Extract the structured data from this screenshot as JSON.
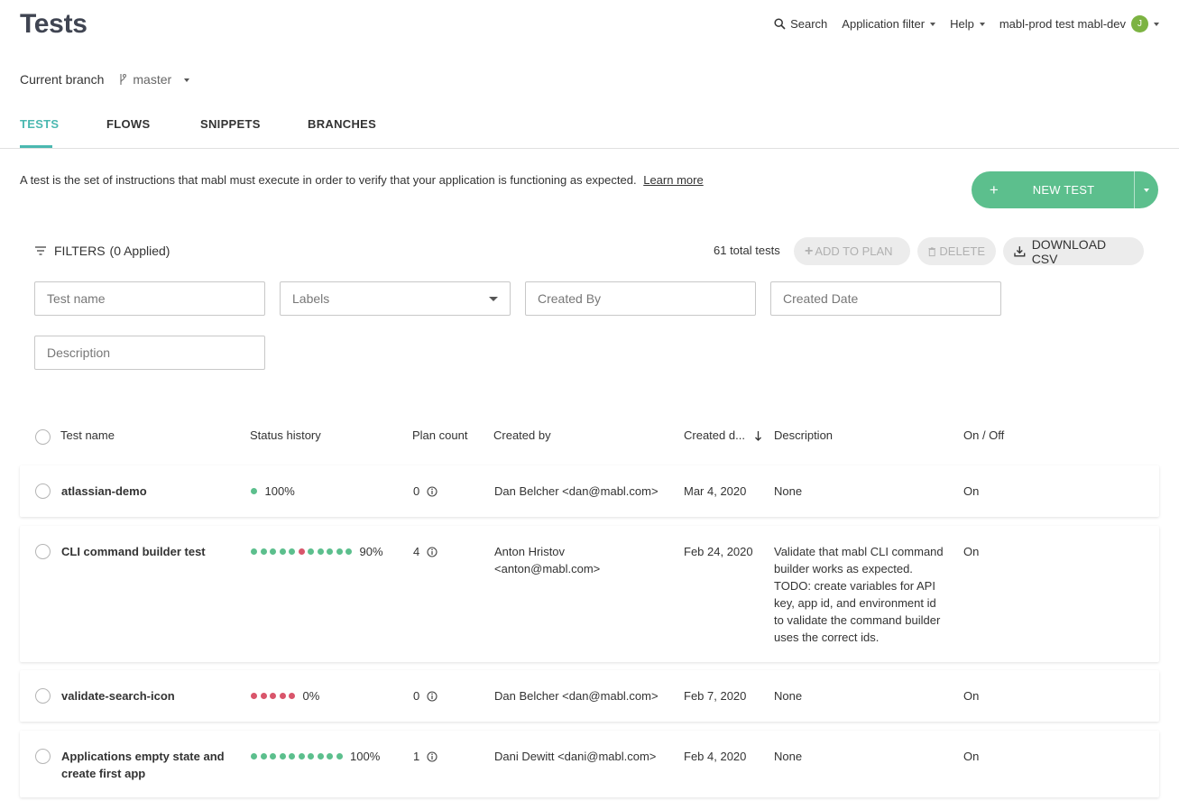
{
  "header": {
    "title": "Tests",
    "search_label": "Search",
    "app_filter_label": "Application filter",
    "help_label": "Help",
    "workspace_label": "mabl-prod test mabl-dev",
    "avatar_initial": "J"
  },
  "branch": {
    "label": "Current branch",
    "value": "master"
  },
  "tabs": [
    {
      "label": "TESTS"
    },
    {
      "label": "FLOWS"
    },
    {
      "label": "SNIPPETS"
    },
    {
      "label": "BRANCHES"
    }
  ],
  "intro": {
    "text": "A test is the set of instructions that mabl must execute in order to verify that your application is functioning as expected.",
    "link": "Learn more"
  },
  "new_test": {
    "plus": "+",
    "label": "NEW TEST"
  },
  "filters": {
    "label": "FILTERS",
    "applied": "(0 Applied)",
    "total": "61 total tests",
    "add_to_plan": "ADD TO PLAN",
    "delete": "DELETE",
    "download_csv": "DOWNLOAD CSV",
    "fields": {
      "test_name": "Test name",
      "labels": "Labels",
      "created_by": "Created By",
      "created_date": "Created Date",
      "description": "Description"
    }
  },
  "table": {
    "columns": {
      "name": "Test name",
      "status": "Status history",
      "plan": "Plan count",
      "created_by": "Created by",
      "created_date": "Created d...",
      "description": "Description",
      "onoff": "On / Off"
    },
    "rows": [
      {
        "name": "atlassian-demo",
        "name_line2": "",
        "status": [
          "g"
        ],
        "pct": "100%",
        "plan": "0",
        "created_by": "Dan Belcher <dan@mabl.com>",
        "created_by_line2": "",
        "created_date": "Mar 4, 2020",
        "description": [
          "None"
        ],
        "onoff": "On"
      },
      {
        "name": "CLI command builder test",
        "name_line2": "",
        "status": [
          "g",
          "g",
          "g",
          "g",
          "g",
          "r",
          "g",
          "g",
          "g",
          "g",
          "g"
        ],
        "pct": "90%",
        "plan": "4",
        "created_by": "Anton Hristov",
        "created_by_line2": "<anton@mabl.com>",
        "created_date": "Feb 24, 2020",
        "description": [
          "Validate that mabl CLI command",
          "builder works as expected.",
          "TODO: create variables for API",
          "key, app id, and environment id",
          "to validate the command builder",
          "uses the correct ids."
        ],
        "onoff": "On"
      },
      {
        "name": "validate-search-icon",
        "name_line2": "",
        "status": [
          "r",
          "r",
          "r",
          "r",
          "r"
        ],
        "pct": "0%",
        "plan": "0",
        "created_by": "Dan Belcher <dan@mabl.com>",
        "created_by_line2": "",
        "created_date": "Feb 7, 2020",
        "description": [
          "None"
        ],
        "onoff": "On"
      },
      {
        "name": "Applications empty state and",
        "name_line2": "create first app",
        "status": [
          "g",
          "g",
          "g",
          "g",
          "g",
          "g",
          "g",
          "g",
          "g",
          "g"
        ],
        "pct": "100%",
        "plan": "1",
        "created_by": "Dani Dewitt <dani@mabl.com>",
        "created_by_line2": "",
        "created_date": "Feb 4, 2020",
        "description": [
          "None"
        ],
        "onoff": "On"
      }
    ]
  }
}
